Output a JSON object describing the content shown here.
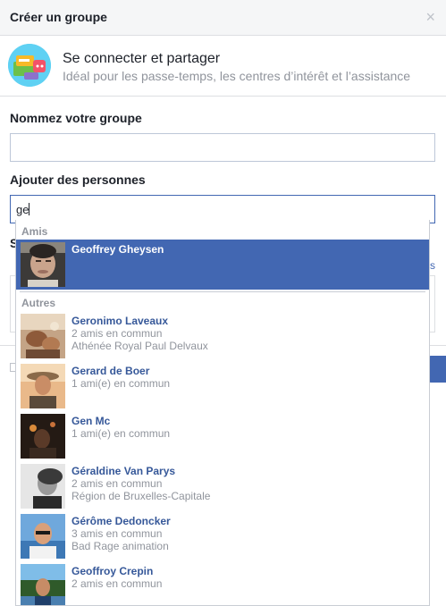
{
  "dialog": {
    "title": "Créer un groupe",
    "close_label": "×"
  },
  "group_type": {
    "icon": "group-category-icon",
    "title": "Se connecter et partager",
    "subtitle": "Idéal pour les passe-temps, les centres d’intérêt et l’assistance"
  },
  "name_field": {
    "label": "Nommez votre groupe",
    "value": ""
  },
  "people_field": {
    "label": "Ajouter des personnes",
    "value": "ge"
  },
  "background": {
    "section_letter": "S",
    "link_fragment": "s"
  },
  "suggestions": {
    "friends_header": "Amis",
    "friends": [
      {
        "name": "Geoffrey Gheysen",
        "line2": "",
        "line3": "",
        "selected": true
      }
    ],
    "others_header": "Autres",
    "others": [
      {
        "name": "Geronimo Laveaux",
        "line2": "2 amis en commun",
        "line3": "Athénée Royal Paul Delvaux"
      },
      {
        "name": "Gerard de Boer",
        "line2": "1 ami(e) en commun",
        "line3": ""
      },
      {
        "name": "Gen Mc",
        "line2": "1 ami(e) en commun",
        "line3": ""
      },
      {
        "name": "Géraldine Van Parys",
        "line2": "2 amis en commun",
        "line3": "Région de Bruxelles-Capitale"
      },
      {
        "name": "Gérôme Dedoncker",
        "line2": "3 amis en commun",
        "line3": "Bad Rage animation"
      },
      {
        "name": "Geoffroy Crepin",
        "line2": "2 amis en commun",
        "line3": ""
      }
    ]
  },
  "colors": {
    "accent": "#4267b2",
    "link": "#365899",
    "muted": "#90949c"
  }
}
